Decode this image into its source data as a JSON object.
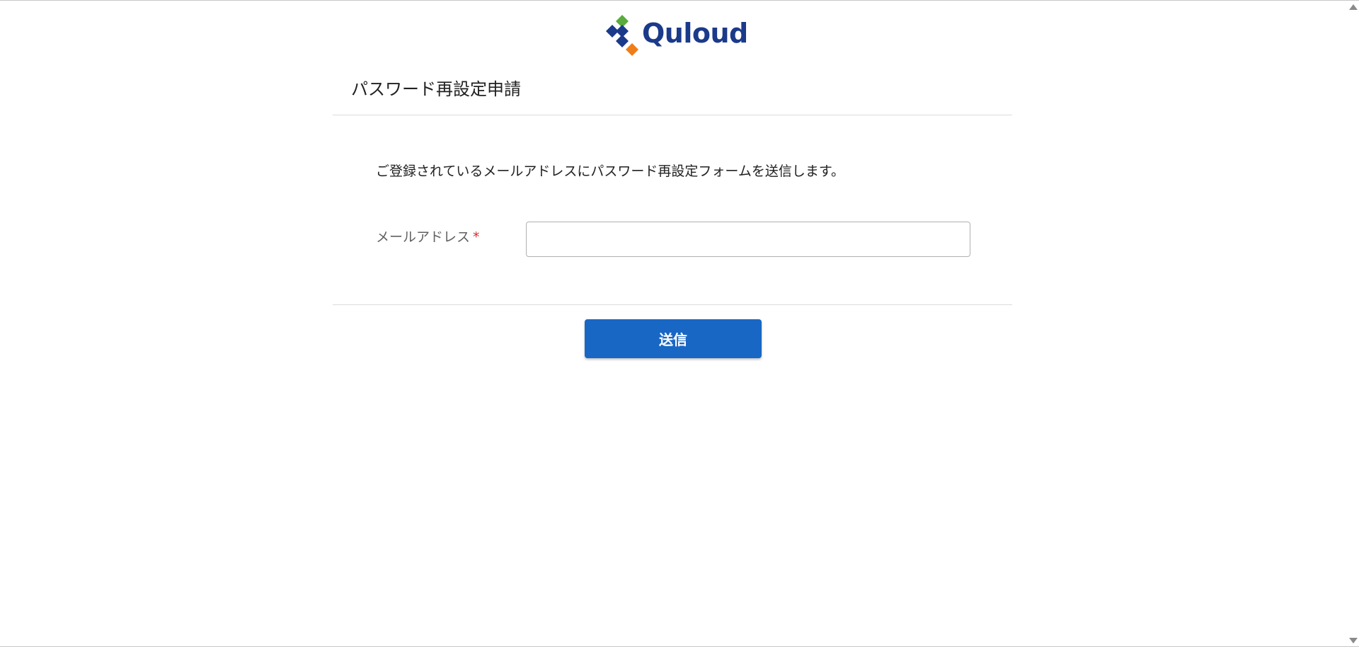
{
  "brand": {
    "name": "Quloud",
    "colors": {
      "navy": "#1b3a8a",
      "green": "#5aac3c",
      "orange": "#ef7d1a"
    }
  },
  "page": {
    "title": "パスワード再設定申請",
    "description": "ご登録されているメールアドレスにパスワード再設定フォームを送信します。"
  },
  "form": {
    "email": {
      "label": "メールアドレス",
      "required_mark": "*",
      "value": "",
      "placeholder": ""
    },
    "submit_label": "送信"
  },
  "colors": {
    "primary_button": "#1967c4",
    "required": "#d32f2f"
  },
  "icons": {
    "logo": "quloud-diamond-logo-icon",
    "scroll_up": "triangle-up-icon",
    "scroll_down": "triangle-down-icon"
  }
}
